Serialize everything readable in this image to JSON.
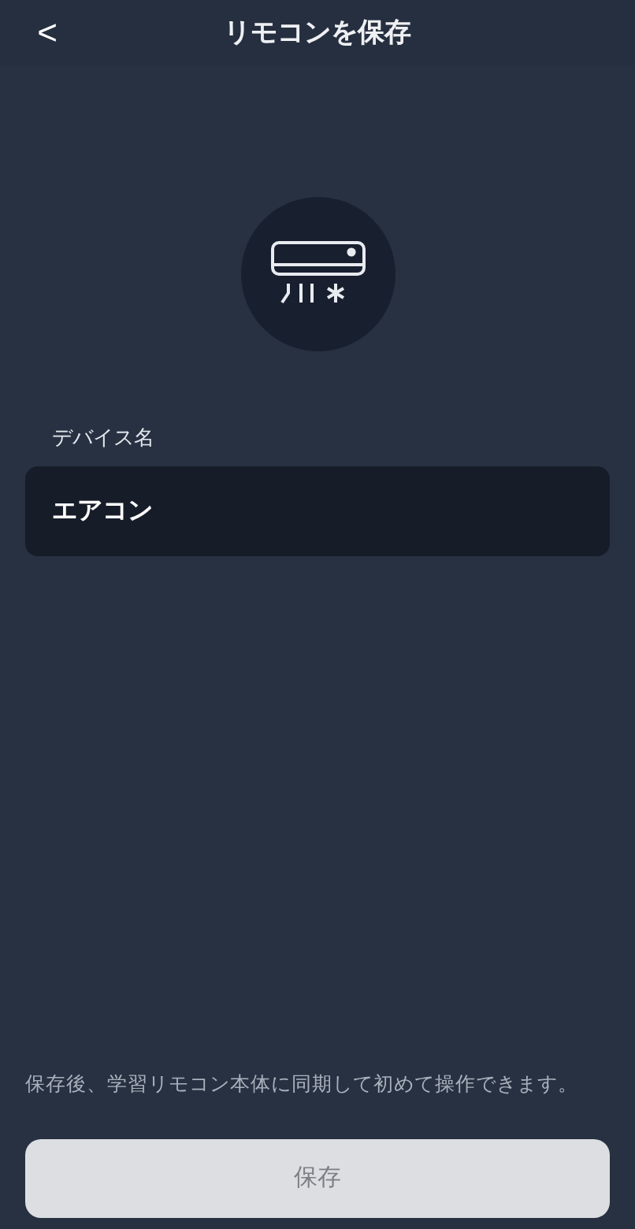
{
  "header": {
    "back": "<",
    "title": "リモコンを保存"
  },
  "device_name": {
    "label": "デバイス名",
    "value": "エアコン"
  },
  "note": "保存後、学習リモコン本体に同期して初めて操作できます。",
  "save_button": {
    "label": "保存",
    "disabled": true
  }
}
